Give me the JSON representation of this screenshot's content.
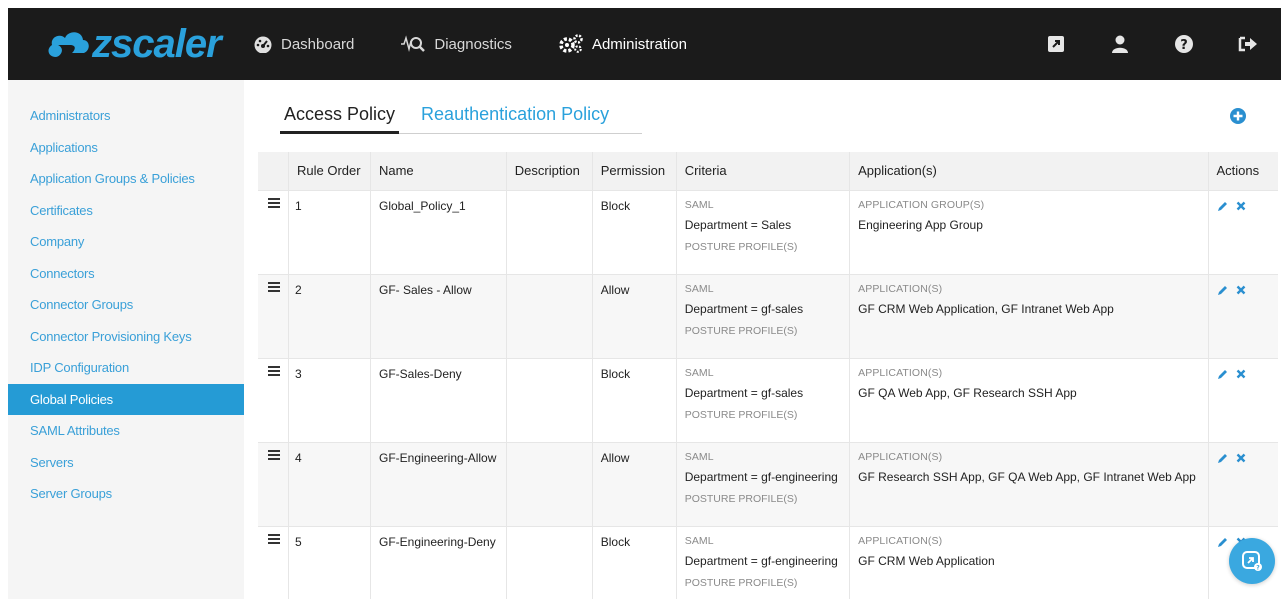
{
  "brand": {
    "name": "zscaler",
    "color": "#2aa1dc"
  },
  "topnav": {
    "items": [
      {
        "label": "Dashboard",
        "icon": "dashboard-icon"
      },
      {
        "label": "Diagnostics",
        "icon": "diagnostics-icon"
      },
      {
        "label": "Administration",
        "icon": "gears-icon"
      }
    ],
    "active": "Administration",
    "right_icons": [
      "external-link-icon",
      "user-icon",
      "help-icon",
      "sign-out-icon"
    ]
  },
  "sidebar": {
    "items": [
      {
        "label": "Administrators"
      },
      {
        "label": "Applications"
      },
      {
        "label": "Application Groups & Policies"
      },
      {
        "label": "Certificates"
      },
      {
        "label": "Company"
      },
      {
        "label": "Connectors"
      },
      {
        "label": "Connector Groups"
      },
      {
        "label": "Connector Provisioning Keys"
      },
      {
        "label": "IDP Configuration"
      },
      {
        "label": "Global Policies"
      },
      {
        "label": "SAML Attributes"
      },
      {
        "label": "Servers"
      },
      {
        "label": "Server Groups"
      }
    ],
    "active_index": 9
  },
  "tabs": [
    {
      "label": "Access Policy"
    },
    {
      "label": "Reauthentication Policy"
    }
  ],
  "table": {
    "headers": {
      "rule_order": "Rule Order",
      "name": "Name",
      "description": "Description",
      "permission": "Permission",
      "criteria": "Criteria",
      "applications": "Application(s)",
      "actions": "Actions"
    },
    "rows": [
      {
        "order": "1",
        "name": "Global_Policy_1",
        "description": "",
        "permission": "Block",
        "criteria_type": "SAML",
        "criteria_value": "Department = Sales",
        "posture": "POSTURE PROFILE(S)",
        "app_type": "APPLICATION GROUP(S)",
        "apps": "Engineering App Group"
      },
      {
        "order": "2",
        "name": "GF- Sales - Allow",
        "description": "",
        "permission": "Allow",
        "criteria_type": "SAML",
        "criteria_value": "Department = gf-sales",
        "posture": "POSTURE PROFILE(S)",
        "app_type": "APPLICATION(S)",
        "apps": "GF CRM Web Application, GF Intranet Web App"
      },
      {
        "order": "3",
        "name": "GF-Sales-Deny",
        "description": "",
        "permission": "Block",
        "criteria_type": "SAML",
        "criteria_value": "Department = gf-sales",
        "posture": "POSTURE PROFILE(S)",
        "app_type": "APPLICATION(S)",
        "apps": "GF QA Web App, GF Research SSH App"
      },
      {
        "order": "4",
        "name": "GF-Engineering-Allow",
        "description": "",
        "permission": "Allow",
        "criteria_type": "SAML",
        "criteria_value": "Department = gf-engineering",
        "posture": "POSTURE PROFILE(S)",
        "app_type": "APPLICATION(S)",
        "apps": "GF Research SSH App, GF QA Web App, GF Intranet Web App"
      },
      {
        "order": "5",
        "name": "GF-Engineering-Deny",
        "description": "",
        "permission": "Block",
        "criteria_type": "SAML",
        "criteria_value": "Department = gf-engineering",
        "posture": "POSTURE PROFILE(S)",
        "app_type": "APPLICATION(S)",
        "apps": "GF CRM Web Application"
      }
    ]
  },
  "colors": {
    "accent": "#2aa1dc",
    "block": "#d9534f",
    "allow": "#5cb85c",
    "sidebar_active": "#259bd5"
  }
}
